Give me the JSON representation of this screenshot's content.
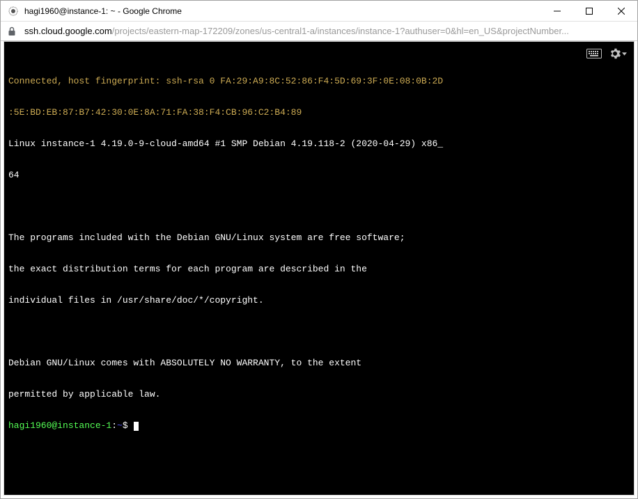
{
  "window": {
    "title": "hagi1960@instance-1: ~ - Google Chrome"
  },
  "url": {
    "host": "ssh.cloud.google.com",
    "path": "/projects/eastern-map-172209/zones/us-central1-a/instances/instance-1?authuser=0&hl=en_US&projectNumber..."
  },
  "terminal": {
    "line1": "Connected, host fingerprint: ssh-rsa 0 FA:29:A9:8C:52:86:F4:5D:69:3F:0E:08:0B:2D",
    "line2": ":5E:BD:EB:87:B7:42:30:0E:8A:71:FA:38:F4:CB:96:C2:B4:89",
    "line3": "Linux instance-1 4.19.0-9-cloud-amd64 #1 SMP Debian 4.19.118-2 (2020-04-29) x86_",
    "line4": "64",
    "line5": "",
    "line6": "The programs included with the Debian GNU/Linux system are free software;",
    "line7": "the exact distribution terms for each program are described in the",
    "line8": "individual files in /usr/share/doc/*/copyright.",
    "line9": "",
    "line10": "Debian GNU/Linux comes with ABSOLUTELY NO WARRANTY, to the extent",
    "line11": "permitted by applicable law.",
    "prompt_user": "hagi1960@instance-1",
    "prompt_colon": ":",
    "prompt_path": "~",
    "prompt_symbol": "$ "
  }
}
